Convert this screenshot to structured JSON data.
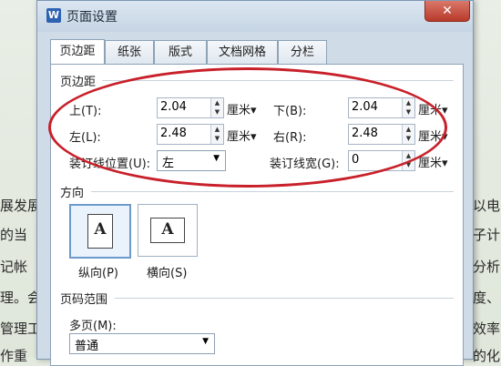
{
  "background_doc": {
    "left_fragments": [
      "展发展",
      "的当",
      "记帐",
      "理。会",
      "管理工",
      "作重"
    ],
    "right_fragments": [
      "以电",
      "子计",
      "分析",
      "度、",
      "效率",
      "的化"
    ]
  },
  "dialog": {
    "app_icon_text": "W",
    "title": "页面设置",
    "close_glyph": "✕",
    "tabs": [
      {
        "label": "页边距",
        "active": true
      },
      {
        "label": "纸张",
        "active": false
      },
      {
        "label": "版式",
        "active": false
      },
      {
        "label": "文档网格",
        "active": false
      },
      {
        "label": "分栏",
        "active": false
      }
    ],
    "margins": {
      "group_label": "页边距",
      "top_label": "上(T):",
      "top_value": "2.04",
      "bottom_label": "下(B):",
      "bottom_value": "2.04",
      "left_label": "左(L):",
      "left_value": "2.48",
      "right_label": "右(R):",
      "right_value": "2.48",
      "unit": "厘米",
      "gutter_position_label": "装订线位置(U):",
      "gutter_position_value": "左",
      "gutter_width_label": "装订线宽(G):",
      "gutter_width_value": "0"
    },
    "orientation": {
      "group_label": "方向",
      "icon_letter": "A",
      "portrait_label": "纵向(P)",
      "landscape_label": "横向(S)",
      "selected": "portrait"
    },
    "page_range": {
      "group_label": "页码范围",
      "multi_label": "多页(M):",
      "multi_value": "普通"
    },
    "annotation_color": "#c8202a"
  }
}
